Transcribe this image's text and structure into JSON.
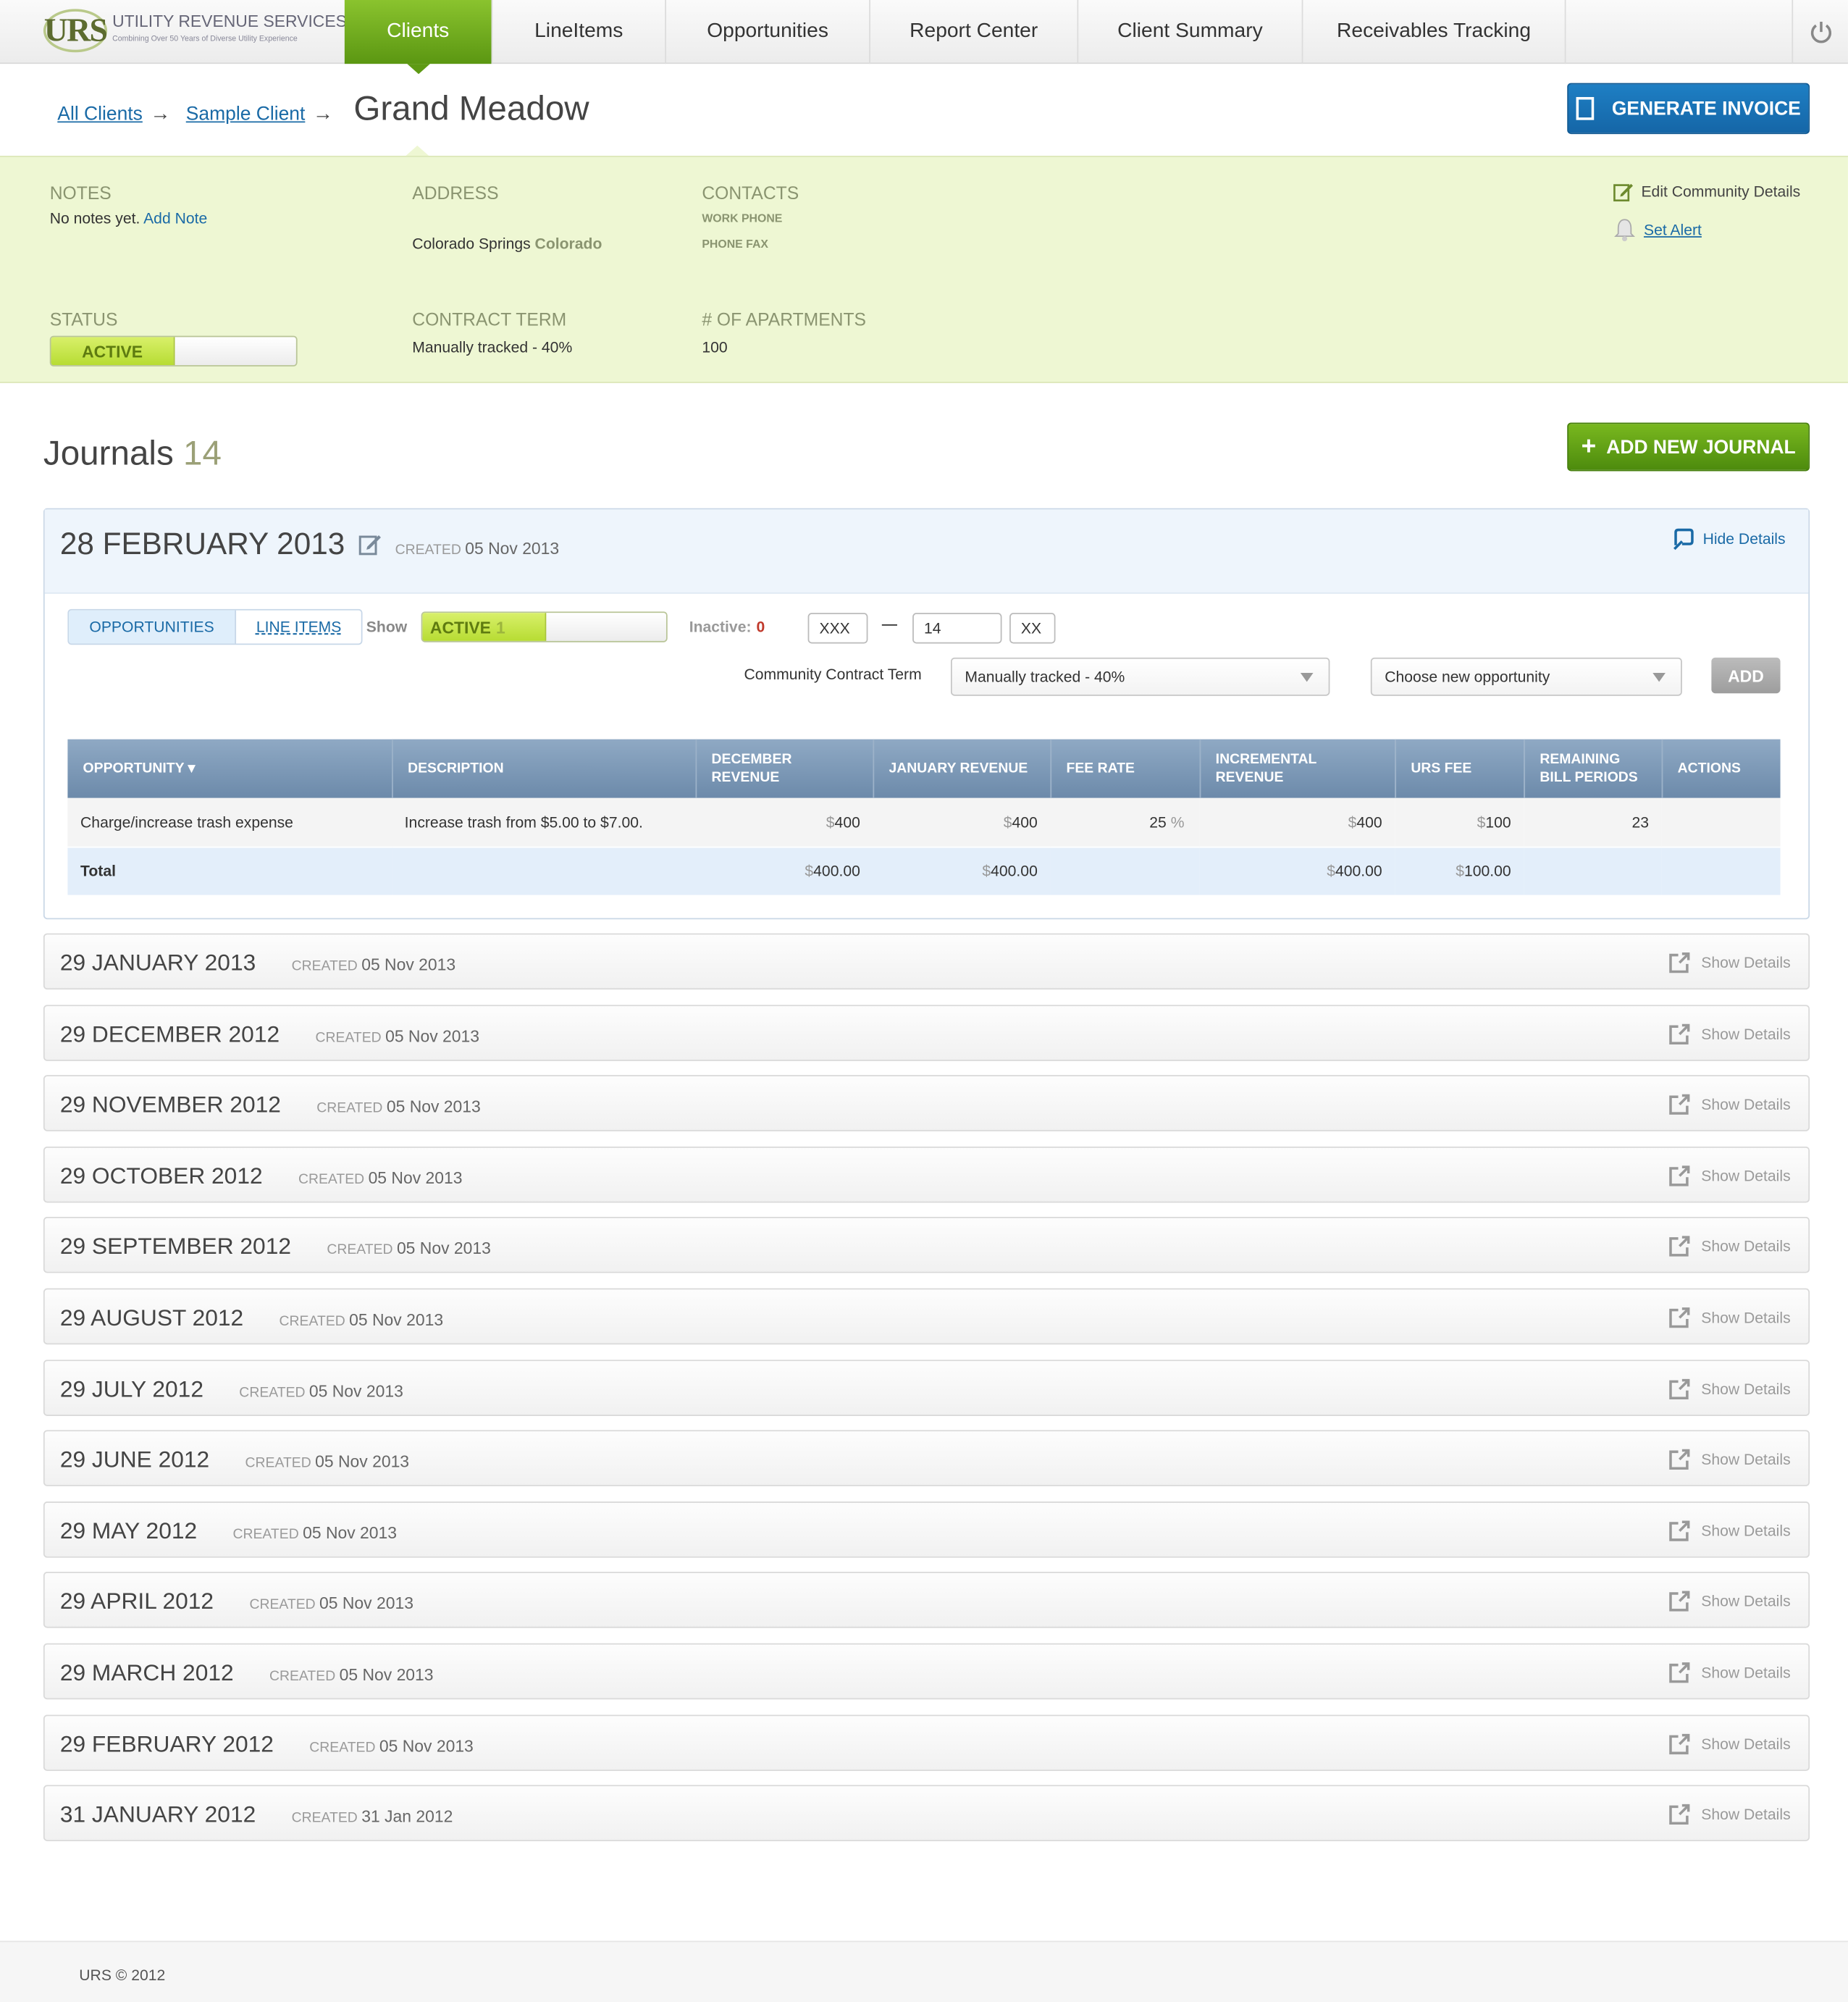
{
  "brand": {
    "logo_mark": "URS",
    "logo_name": "UTILITY REVENUE SERVICES",
    "logo_tagline": "Combining Over 50 Years of Diverse Utility Experience"
  },
  "nav": {
    "tabs": [
      {
        "label": "Clients",
        "active": true
      },
      {
        "label": "LineItems"
      },
      {
        "label": "Opportunities"
      },
      {
        "label": "Report Center"
      },
      {
        "label": "Client Summary"
      },
      {
        "label": "Receivables Tracking"
      }
    ],
    "power_icon": "power-icon"
  },
  "breadcrumb": {
    "all_clients": "All Clients",
    "sample_client": "Sample Client",
    "arrow": "→",
    "current": "Grand Meadow"
  },
  "generate_invoice": "GENERATE INVOICE",
  "info": {
    "notes_label": "NOTES",
    "notes_text": "No notes yet.",
    "add_note": "Add Note",
    "address_label": "ADDRESS",
    "city": "Colorado Springs",
    "state": "Colorado",
    "contacts_label": "CONTACTS",
    "work_phone": "WORK PHONE",
    "phone_fax": "PHONE FAX",
    "status_label": "STATUS",
    "status_value": "ACTIVE",
    "contract_label": "CONTRACT TERM",
    "contract_value": "Manually tracked - 40%",
    "apartments_label": "# OF APARTMENTS",
    "apartments_value": "100",
    "edit_details": "Edit Community Details",
    "set_alert": "Set Alert"
  },
  "journals": {
    "title": "Journals",
    "count": "14",
    "add_button": "ADD  NEW JOURNAL",
    "created_label": "CREATED",
    "open": {
      "date": "28 FEBRUARY 2013",
      "created": "05 Nov 2013",
      "hide": "Hide Details",
      "seg_opportunities": "OPPORTUNITIES",
      "seg_line_items": "LINE ITEMS",
      "show_label": "Show",
      "active_label": "ACTIVE",
      "active_count": "1",
      "inactive_label": "Inactive:",
      "inactive_count": "0",
      "field1": "XXX",
      "dash": "—",
      "field2": "14",
      "field3": "XX",
      "contract_label": "Community Contract Term",
      "contract_select": "Manually tracked - 40%",
      "opportunity_select": "Choose new opportunity",
      "add_button": "ADD",
      "table": {
        "headers": [
          "OPPORTUNITY ▾",
          "DESCRIPTION",
          "DECEMBER REVENUE",
          "JANUARY REVENUE",
          "FEE RATE",
          "INCREMENTAL REVENUE",
          "URS FEE",
          "REMAINING BILL PERIODS",
          "ACTIONS"
        ],
        "row": {
          "opportunity": "Charge/increase trash expense",
          "description": "Increase trash from $5.00 to $7.00.",
          "december": "400",
          "january": "400",
          "fee_rate": "25",
          "incremental": "400",
          "urs_fee": "100",
          "remaining": "23"
        },
        "total": {
          "label": "Total",
          "december": "400.00",
          "january": "400.00",
          "incremental": "400.00",
          "urs_fee": "100.00"
        },
        "currency": "$",
        "percent": "%"
      }
    },
    "show_details": "Show Details",
    "list": [
      {
        "date": "29 JANUARY 2013",
        "created": "05 Nov 2013"
      },
      {
        "date": "29 DECEMBER 2012",
        "created": "05 Nov 2013"
      },
      {
        "date": "29 NOVEMBER 2012",
        "created": "05 Nov 2013"
      },
      {
        "date": "29 OCTOBER 2012",
        "created": "05 Nov 2013"
      },
      {
        "date": "29 SEPTEMBER 2012",
        "created": "05 Nov 2013"
      },
      {
        "date": "29 AUGUST 2012",
        "created": "05 Nov 2013"
      },
      {
        "date": "29 JULY 2012",
        "created": "05 Nov 2013"
      },
      {
        "date": "29 JUNE 2012",
        "created": "05 Nov 2013"
      },
      {
        "date": "29 MAY 2012",
        "created": "05 Nov 2013"
      },
      {
        "date": "29 APRIL 2012",
        "created": "05 Nov 2013"
      },
      {
        "date": "29 MARCH 2012",
        "created": "05 Nov 2013"
      },
      {
        "date": "29 FEBRUARY 2012",
        "created": "05 Nov 2013"
      },
      {
        "date": "31 JANUARY 2012",
        "created": "31 Jan 2012"
      }
    ]
  },
  "footer": "URS © 2012",
  "colors": {
    "accent_green": "#5b9712",
    "accent_blue": "#1566a7",
    "panel_bg": "#eef7d3"
  }
}
